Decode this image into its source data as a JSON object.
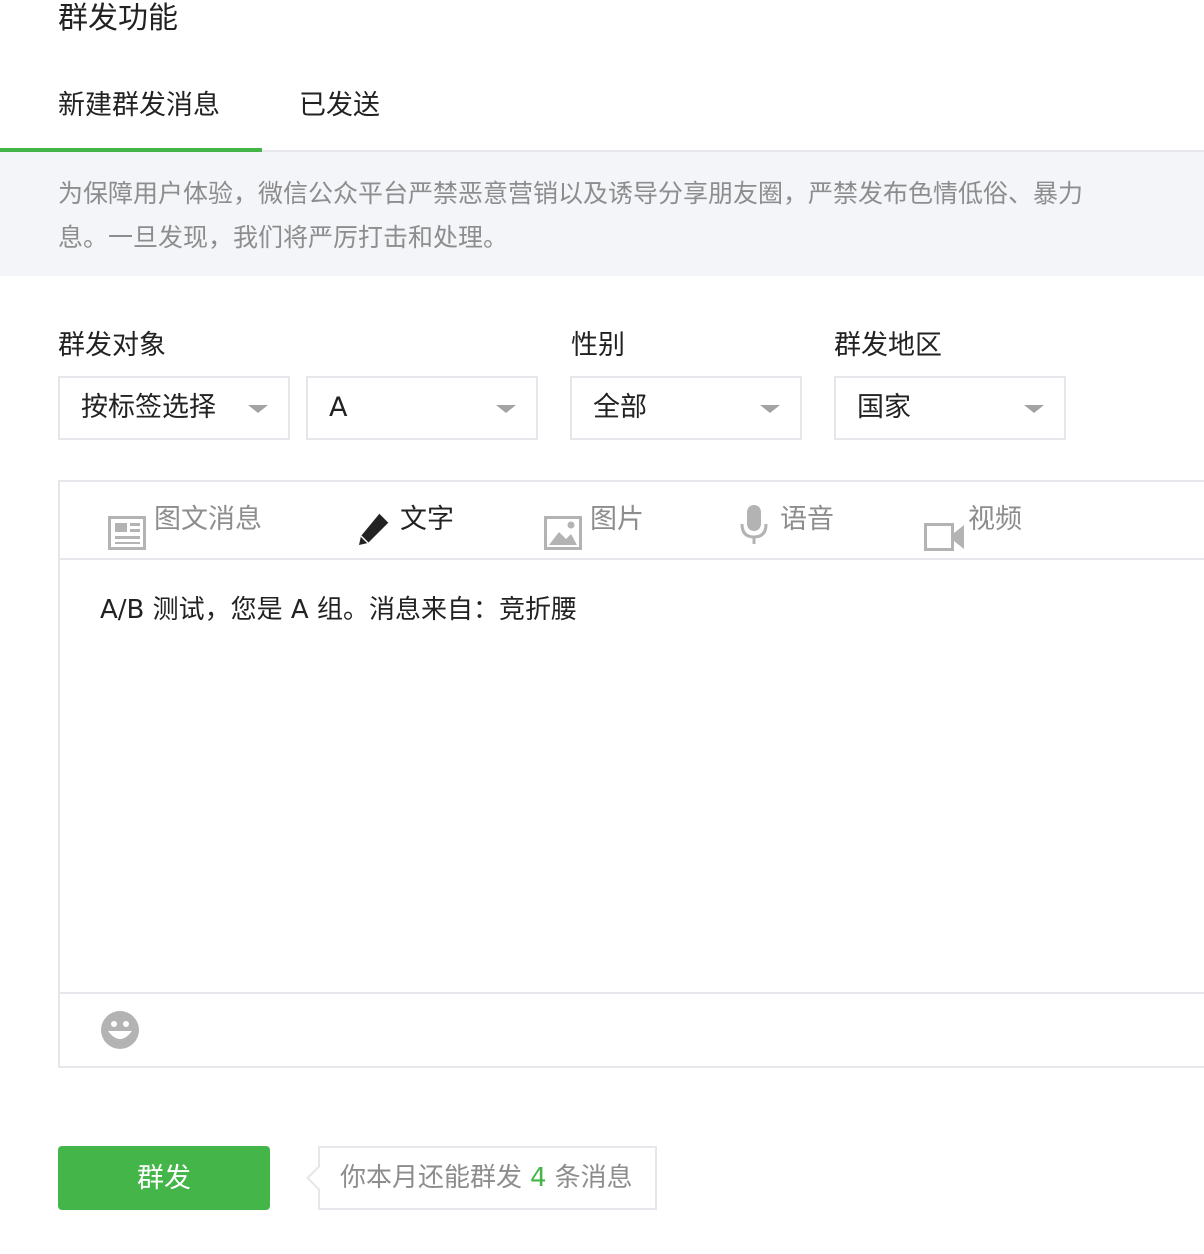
{
  "page_title": "群发功能",
  "tabs": [
    {
      "label": "新建群发消息",
      "active": true
    },
    {
      "label": "已发送",
      "active": false
    }
  ],
  "notice": {
    "line1": "为保障用户体验，微信公众平台严禁恶意营销以及诱导分享朋友圈，严禁发布色情低俗、暴力",
    "line2": "息。一旦发现，我们将严厉打击和处理。"
  },
  "filters": {
    "target_label": "群发对象",
    "target_select": "按标签选择",
    "tag_select": "A",
    "gender_label": "性别",
    "gender_select": "全部",
    "region_label": "群发地区",
    "region_select": "国家"
  },
  "message_types": [
    {
      "label": "图文消息",
      "icon": "article-icon",
      "active": false
    },
    {
      "label": "文字",
      "icon": "pencil-icon",
      "active": true
    },
    {
      "label": "图片",
      "icon": "image-icon",
      "active": false
    },
    {
      "label": "语音",
      "icon": "microphone-icon",
      "active": false
    },
    {
      "label": "视频",
      "icon": "video-icon",
      "active": false
    }
  ],
  "editor": {
    "content": "A/B 测试，您是 A 组。消息来自：竞折腰",
    "emoji_icon": "emoji-icon"
  },
  "send_button": "群发",
  "quota": {
    "prefix": "你本月还能群发",
    "count": "4",
    "suffix": "条消息"
  },
  "colors": {
    "accent": "#44b549",
    "notice_bg": "#f4f5f9",
    "border": "#e7e7eb",
    "muted_text": "#8d8d8d"
  }
}
